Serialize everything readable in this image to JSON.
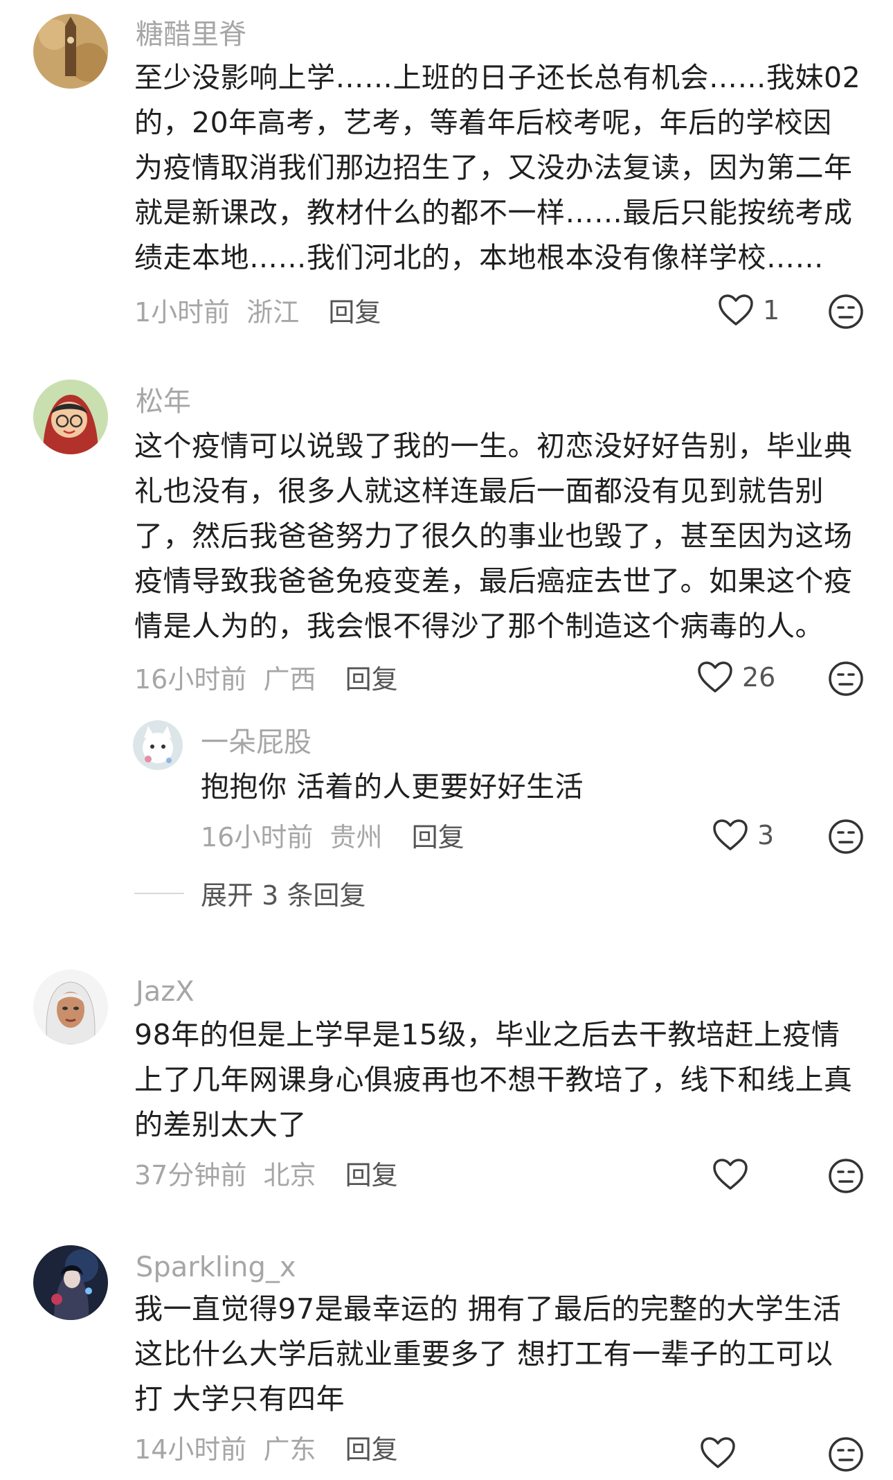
{
  "comments": [
    {
      "username": "糖醋里脊",
      "lines": [
        "至少没影响上学……上班的日子还长总有机会……我妹02",
        "的，20年高考，艺考，等着年后校考呢，年后的学校因",
        "为疫情取消我们那边招生了，又没办法复读，因为第二年",
        "就是新课改，教材什么的都不一样……最后只能按统考成",
        "绩走本地……我们河北的，本地根本没有像样学校……"
      ],
      "time": "1小时前",
      "location": "浙江",
      "reply_label": "回复",
      "likes": "1"
    },
    {
      "username": "松年",
      "lines": [
        "这个疫情可以说毁了我的一生。初恋没好好告别，毕业典",
        "礼也没有，很多人就这样连最后一面都没有见到就告别",
        "了，然后我爸爸努力了很久的事业也毁了，甚至因为这场",
        "疫情导致我爸爸免疫变差，最后癌症去世了。如果这个疫",
        "情是人为的，我会恨不得沙了那个制造这个病毒的人。"
      ],
      "time": "16小时前",
      "location": "广西",
      "reply_label": "回复",
      "likes": "26",
      "sub_reply": {
        "username": "一朵屁股",
        "text": "抱抱你  活着的人更要好好生活",
        "time": "16小时前",
        "location": "贵州",
        "reply_label": "回复",
        "likes": "3"
      },
      "expand_label": "展开 3 条回复"
    },
    {
      "username": "JazX",
      "lines": [
        "98年的但是上学早是15级，毕业之后去干教培赶上疫情",
        "上了几年网课身心俱疲再也不想干教培了，线下和线上真",
        "的差别太大了"
      ],
      "time": "37分钟前",
      "location": "北京",
      "reply_label": "回复",
      "likes": ""
    },
    {
      "username": "Sparkling_x",
      "lines": [
        "我一直觉得97是最幸运的 拥有了最后的完整的大学生活",
        "这比什么大学后就业重要多了 想打工有一辈子的工可以",
        "打 大学只有四年"
      ],
      "time": "14小时前",
      "location": "广东",
      "reply_label": "回复",
      "likes": ""
    }
  ],
  "icons": {
    "like": "heart-outline-icon",
    "emoji": "neutral-face-icon"
  },
  "colors": {
    "username": "#a6a6a6",
    "body": "#1f1f1f",
    "meta": "#a6a6a6",
    "icon": "#333333"
  }
}
